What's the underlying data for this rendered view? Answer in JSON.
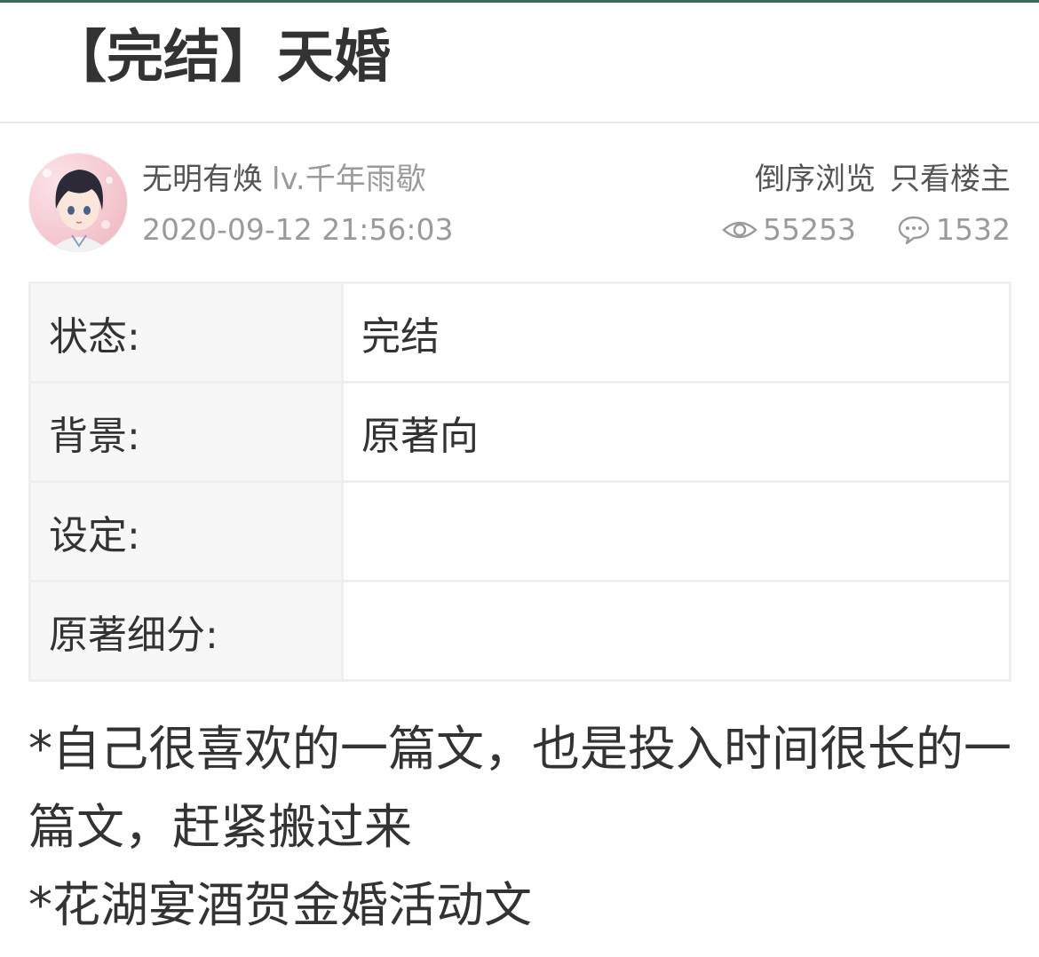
{
  "post": {
    "title": "【完结】天婚"
  },
  "author": {
    "name": "无明有焕",
    "level": "lv.千年雨歇",
    "time": "2020-09-12 21:56:03"
  },
  "actions": {
    "reverse_order": "倒序浏览",
    "only_op": "只看楼主"
  },
  "stats": {
    "views": "55253",
    "replies": "1532",
    "views_icon": "eye-icon",
    "replies_icon": "comment-bubble-icon"
  },
  "info_table": {
    "rows": [
      {
        "key": "状态:",
        "value": "完结"
      },
      {
        "key": "背景:",
        "value": "原著向"
      },
      {
        "key": "设定:",
        "value": ""
      },
      {
        "key": "原著细分:",
        "value": ""
      }
    ]
  },
  "content": {
    "lines": [
      "*自己很喜欢的一篇文，也是投入时间很长的一篇文，赶紧搬过来",
      "*花湖宴酒贺金婚活动文"
    ]
  },
  "colors": {
    "accent_top": "#3d6b57",
    "text": "#333333",
    "muted": "#9a9a9a",
    "table_border": "#eeeeee",
    "table_key_bg": "#f7f7f7"
  }
}
